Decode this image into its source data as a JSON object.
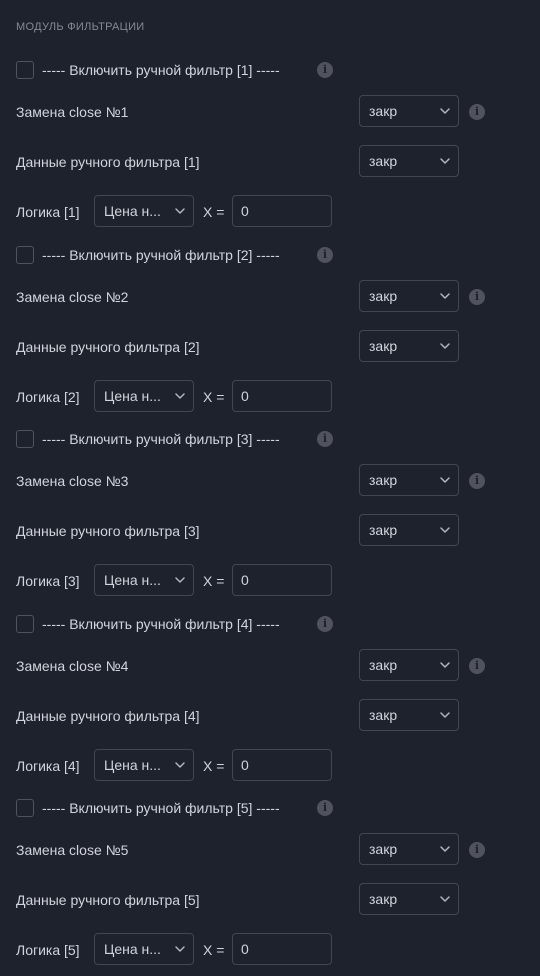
{
  "section": {
    "title": "МОДУЛЬ ФИЛЬТРАЦИИ"
  },
  "info_icon_glyph": "i",
  "filters": [
    {
      "enable_label": "----- Включить ручной фильтр [1] -----",
      "replace_label": "Замена close №1",
      "replace_value": "закр",
      "data_label": "Данные ручного фильтра [1]",
      "data_value": "закр",
      "logic_label": "Логика [1]",
      "logic_value": "Цена н...",
      "x_label": "X =",
      "x_value": "0"
    },
    {
      "enable_label": "----- Включить ручной фильтр [2] -----",
      "replace_label": "Замена close №2",
      "replace_value": "закр",
      "data_label": "Данные ручного фильтра [2]",
      "data_value": "закр",
      "logic_label": "Логика [2]",
      "logic_value": "Цена н...",
      "x_label": "X =",
      "x_value": "0"
    },
    {
      "enable_label": "----- Включить ручной фильтр [3] -----",
      "replace_label": "Замена close №3",
      "replace_value": "закр",
      "data_label": "Данные ручного фильтра [3]",
      "data_value": "закр",
      "logic_label": "Логика [3]",
      "logic_value": "Цена н...",
      "x_label": "X =",
      "x_value": "0"
    },
    {
      "enable_label": "----- Включить ручной фильтр [4] -----",
      "replace_label": "Замена close №4",
      "replace_value": "закр",
      "data_label": "Данные ручного фильтра [4]",
      "data_value": "закр",
      "logic_label": "Логика [4]",
      "logic_value": "Цена н...",
      "x_label": "X =",
      "x_value": "0"
    },
    {
      "enable_label": "----- Включить ручной фильтр [5] -----",
      "replace_label": "Замена close №5",
      "replace_value": "закр",
      "data_label": "Данные ручного фильтра [5]",
      "data_value": "закр",
      "logic_label": "Логика [5]",
      "logic_value": "Цена н...",
      "x_label": "X =",
      "x_value": "0"
    }
  ]
}
